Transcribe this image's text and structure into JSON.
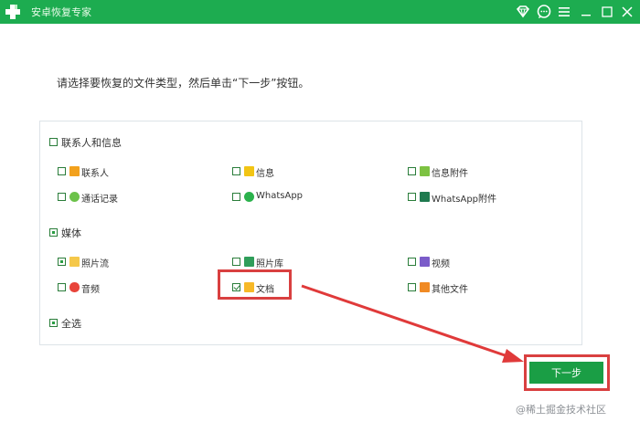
{
  "window": {
    "title": "安卓恢复专家"
  },
  "instruction": "请选择要恢复的文件类型，然后单击“下一步”按钮。",
  "groups": [
    {
      "label": "联系人和信息",
      "checked": false,
      "items": [
        {
          "label": "联系人",
          "checked": false,
          "icon": "contacts-icon"
        },
        {
          "label": "信息",
          "checked": false,
          "icon": "messages-icon"
        },
        {
          "label": "信息附件",
          "checked": false,
          "icon": "attachment-icon"
        },
        {
          "label": "通话记录",
          "checked": false,
          "icon": "phone-icon"
        },
        {
          "label": "WhatsApp",
          "checked": false,
          "icon": "whatsapp-icon"
        },
        {
          "label": "WhatsApp附件",
          "checked": false,
          "icon": "whatsapp-attachment-icon"
        }
      ]
    },
    {
      "label": "媒体",
      "checked": true,
      "items": [
        {
          "label": "照片流",
          "checked": true,
          "icon": "photo-stream-icon"
        },
        {
          "label": "照片库",
          "checked": false,
          "icon": "photo-library-icon"
        },
        {
          "label": "视频",
          "checked": false,
          "icon": "video-icon"
        },
        {
          "label": "音频",
          "checked": false,
          "icon": "audio-icon"
        },
        {
          "label": "文档",
          "checked": true,
          "icon": "folder-icon"
        },
        {
          "label": "其他文件",
          "checked": false,
          "icon": "other-files-icon"
        }
      ]
    }
  ],
  "select_all": {
    "label": "全选",
    "checked": true
  },
  "next_button": {
    "label": "下一步"
  },
  "watermark": "@稀土掘金技术社区",
  "colors": {
    "titlebar": "#1dac50",
    "button": "#1a9e45",
    "highlight": "#d94040"
  }
}
